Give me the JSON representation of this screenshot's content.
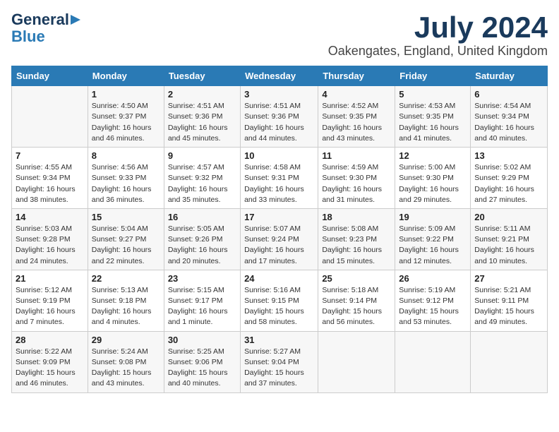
{
  "logo": {
    "line1": "General",
    "line2": "Blue",
    "arrow": "▶"
  },
  "title": {
    "month": "July 2024",
    "location": "Oakengates, England, United Kingdom"
  },
  "calendar": {
    "headers": [
      "Sunday",
      "Monday",
      "Tuesday",
      "Wednesday",
      "Thursday",
      "Friday",
      "Saturday"
    ],
    "weeks": [
      [
        {
          "day": "",
          "info": ""
        },
        {
          "day": "1",
          "info": "Sunrise: 4:50 AM\nSunset: 9:37 PM\nDaylight: 16 hours\nand 46 minutes."
        },
        {
          "day": "2",
          "info": "Sunrise: 4:51 AM\nSunset: 9:36 PM\nDaylight: 16 hours\nand 45 minutes."
        },
        {
          "day": "3",
          "info": "Sunrise: 4:51 AM\nSunset: 9:36 PM\nDaylight: 16 hours\nand 44 minutes."
        },
        {
          "day": "4",
          "info": "Sunrise: 4:52 AM\nSunset: 9:35 PM\nDaylight: 16 hours\nand 43 minutes."
        },
        {
          "day": "5",
          "info": "Sunrise: 4:53 AM\nSunset: 9:35 PM\nDaylight: 16 hours\nand 41 minutes."
        },
        {
          "day": "6",
          "info": "Sunrise: 4:54 AM\nSunset: 9:34 PM\nDaylight: 16 hours\nand 40 minutes."
        }
      ],
      [
        {
          "day": "7",
          "info": "Sunrise: 4:55 AM\nSunset: 9:34 PM\nDaylight: 16 hours\nand 38 minutes."
        },
        {
          "day": "8",
          "info": "Sunrise: 4:56 AM\nSunset: 9:33 PM\nDaylight: 16 hours\nand 36 minutes."
        },
        {
          "day": "9",
          "info": "Sunrise: 4:57 AM\nSunset: 9:32 PM\nDaylight: 16 hours\nand 35 minutes."
        },
        {
          "day": "10",
          "info": "Sunrise: 4:58 AM\nSunset: 9:31 PM\nDaylight: 16 hours\nand 33 minutes."
        },
        {
          "day": "11",
          "info": "Sunrise: 4:59 AM\nSunset: 9:30 PM\nDaylight: 16 hours\nand 31 minutes."
        },
        {
          "day": "12",
          "info": "Sunrise: 5:00 AM\nSunset: 9:30 PM\nDaylight: 16 hours\nand 29 minutes."
        },
        {
          "day": "13",
          "info": "Sunrise: 5:02 AM\nSunset: 9:29 PM\nDaylight: 16 hours\nand 27 minutes."
        }
      ],
      [
        {
          "day": "14",
          "info": "Sunrise: 5:03 AM\nSunset: 9:28 PM\nDaylight: 16 hours\nand 24 minutes."
        },
        {
          "day": "15",
          "info": "Sunrise: 5:04 AM\nSunset: 9:27 PM\nDaylight: 16 hours\nand 22 minutes."
        },
        {
          "day": "16",
          "info": "Sunrise: 5:05 AM\nSunset: 9:26 PM\nDaylight: 16 hours\nand 20 minutes."
        },
        {
          "day": "17",
          "info": "Sunrise: 5:07 AM\nSunset: 9:24 PM\nDaylight: 16 hours\nand 17 minutes."
        },
        {
          "day": "18",
          "info": "Sunrise: 5:08 AM\nSunset: 9:23 PM\nDaylight: 16 hours\nand 15 minutes."
        },
        {
          "day": "19",
          "info": "Sunrise: 5:09 AM\nSunset: 9:22 PM\nDaylight: 16 hours\nand 12 minutes."
        },
        {
          "day": "20",
          "info": "Sunrise: 5:11 AM\nSunset: 9:21 PM\nDaylight: 16 hours\nand 10 minutes."
        }
      ],
      [
        {
          "day": "21",
          "info": "Sunrise: 5:12 AM\nSunset: 9:19 PM\nDaylight: 16 hours\nand 7 minutes."
        },
        {
          "day": "22",
          "info": "Sunrise: 5:13 AM\nSunset: 9:18 PM\nDaylight: 16 hours\nand 4 minutes."
        },
        {
          "day": "23",
          "info": "Sunrise: 5:15 AM\nSunset: 9:17 PM\nDaylight: 16 hours\nand 1 minute."
        },
        {
          "day": "24",
          "info": "Sunrise: 5:16 AM\nSunset: 9:15 PM\nDaylight: 15 hours\nand 58 minutes."
        },
        {
          "day": "25",
          "info": "Sunrise: 5:18 AM\nSunset: 9:14 PM\nDaylight: 15 hours\nand 56 minutes."
        },
        {
          "day": "26",
          "info": "Sunrise: 5:19 AM\nSunset: 9:12 PM\nDaylight: 15 hours\nand 53 minutes."
        },
        {
          "day": "27",
          "info": "Sunrise: 5:21 AM\nSunset: 9:11 PM\nDaylight: 15 hours\nand 49 minutes."
        }
      ],
      [
        {
          "day": "28",
          "info": "Sunrise: 5:22 AM\nSunset: 9:09 PM\nDaylight: 15 hours\nand 46 minutes."
        },
        {
          "day": "29",
          "info": "Sunrise: 5:24 AM\nSunset: 9:08 PM\nDaylight: 15 hours\nand 43 minutes."
        },
        {
          "day": "30",
          "info": "Sunrise: 5:25 AM\nSunset: 9:06 PM\nDaylight: 15 hours\nand 40 minutes."
        },
        {
          "day": "31",
          "info": "Sunrise: 5:27 AM\nSunset: 9:04 PM\nDaylight: 15 hours\nand 37 minutes."
        },
        {
          "day": "",
          "info": ""
        },
        {
          "day": "",
          "info": ""
        },
        {
          "day": "",
          "info": ""
        }
      ]
    ]
  }
}
